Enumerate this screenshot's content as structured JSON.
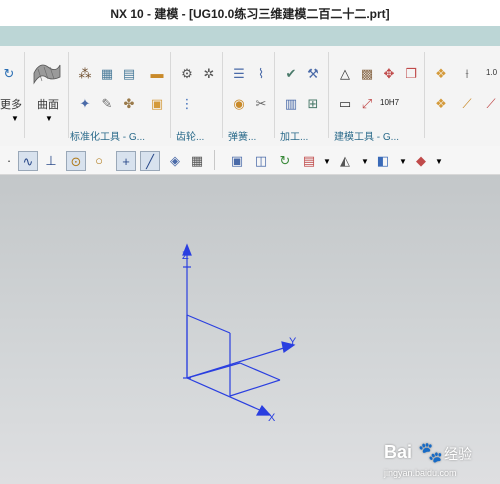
{
  "window": {
    "title": "NX 10 - 建模 - [UG10.0练习三维建模二百二十二.prt]"
  },
  "ribbon": {
    "more_label": "更多",
    "surface_label": "曲面",
    "partial_right_label": "1.0",
    "groups": {
      "standard_tools": "标准化工具 - G...",
      "gear": "齿轮...",
      "spring": "弹簧...",
      "machining": "加工...",
      "modeling_tools": "建模工具 - G..."
    },
    "part_number": "10H7"
  },
  "viewport": {
    "axes": {
      "z": "Z",
      "y": "Y",
      "x": "X"
    },
    "axis_color": "#2a3fe0"
  },
  "watermark": {
    "brand": "Bai",
    "brand_suffix": "经验",
    "url": "jingyan.baidu.com"
  },
  "icons": [
    "rotate-icon",
    "surface-icon",
    "dropdown-arrow-icon",
    "point-set-icon",
    "grid-icon",
    "block-icon",
    "note-icon",
    "tools-icon",
    "wrench-icon",
    "gear-icon",
    "chart-icon",
    "spring-icon",
    "measure-icon",
    "triangle-icon",
    "copy-icon",
    "snap-curve-icon",
    "snap-perp-icon",
    "snap-center-icon",
    "snap-circle-icon",
    "snap-cross-icon",
    "snap-line-icon",
    "view-icon",
    "layer-icon"
  ]
}
